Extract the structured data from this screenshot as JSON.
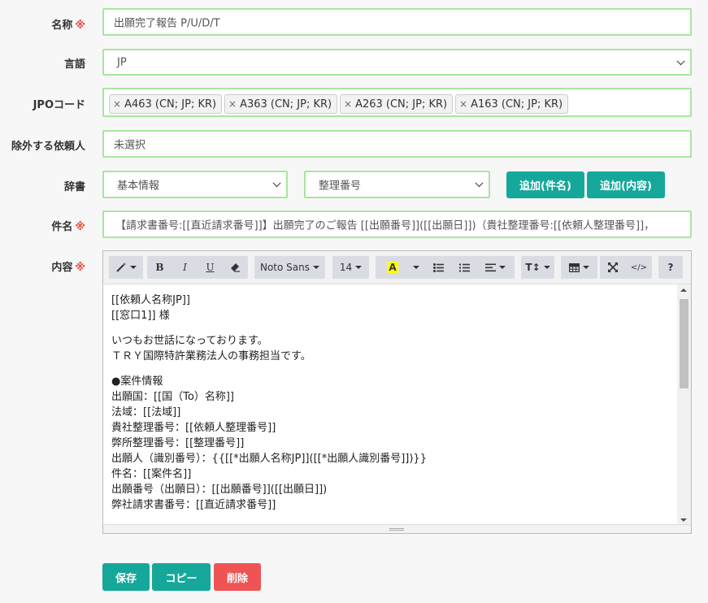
{
  "form": {
    "name": {
      "label": "名称",
      "req": "※",
      "value": "出願完了報告 P/U/D/T"
    },
    "language": {
      "label": "言語",
      "value": "JP"
    },
    "jpo": {
      "label": "JPOコード",
      "tags": [
        "A463 (CN; JP; KR)",
        "A363 (CN; JP; KR)",
        "A263 (CN; JP; KR)",
        "A163 (CN; JP; KR)"
      ],
      "remove": "×"
    },
    "exclude": {
      "label": "除外する依頼人",
      "value": "未選択"
    },
    "dict": {
      "label": "辞書",
      "category": "基本情報",
      "field": "整理番号",
      "add_subject": "追加(件名)",
      "add_content": "追加(内容)"
    },
    "subject": {
      "label": "件名",
      "req": "※",
      "value": "【請求書番号:[[直近請求番号]]】出願完了のご報告 [[出願番号]]([[出願日]])（貴社整理番号:[[依頼人整理番号]]，"
    },
    "content": {
      "label": "内容",
      "req": "※"
    }
  },
  "toolbar": {
    "font": "Noto Sans",
    "size": "14",
    "bold": "B",
    "italic": "I",
    "underline": "U",
    "color_letter": "A",
    "height": "T↕",
    "help": "?",
    "code": "</>"
  },
  "editor_lines": [
    "[[依頼人名称JP]]",
    "[[窓口1]] 様",
    "",
    "いつもお世話になっております。",
    "ＴＲＹ国際特許業務法人の事務担当です。",
    "",
    "●案件情報",
    "出願国：[[国（To）名称]]",
    "法域：[[法域]]",
    "貴社整理番号：[[依頼人整理番号]]",
    "弊所整理番号：[[整理番号]]",
    "出願人（識別番号）：{{[[*出願人名称JP]]([[*出願人識別番号]])}}",
    "件名：[[案件名]]",
    "出願番号（出願日）：[[出願番号]]([[出願日]])",
    "弊社請求書番号：[[直近請求番号]]"
  ],
  "buttons": {
    "save": "保存",
    "copy": "コピー",
    "delete": "削除"
  },
  "colors": {
    "accent": "#15a89a",
    "danger": "#ee5454",
    "input_border": "#a8e6a0",
    "required": "#e74c3c"
  }
}
